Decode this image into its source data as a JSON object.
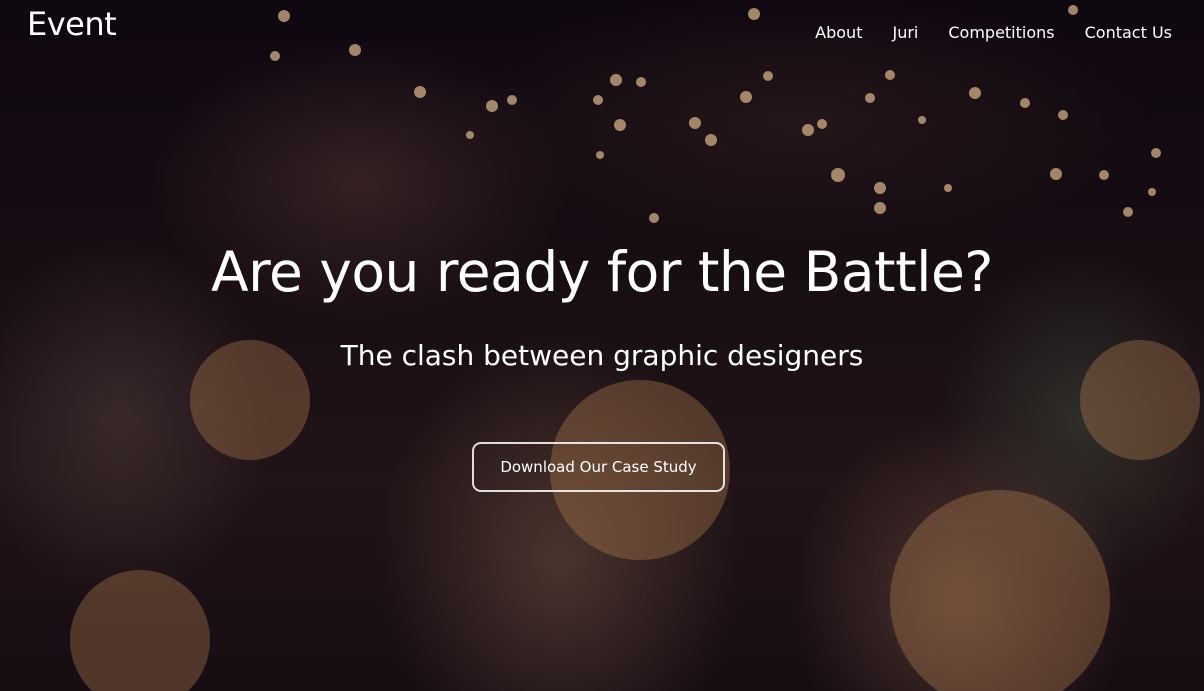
{
  "brand": {
    "logo_text": "Event"
  },
  "nav": {
    "items": [
      {
        "label": "About"
      },
      {
        "label": "Juri"
      },
      {
        "label": "Competitions"
      },
      {
        "label": "Contact Us"
      }
    ]
  },
  "hero": {
    "title": "Are you ready for the Battle?",
    "subtitle": "The clash between graphic designers",
    "cta_label": "Download Our Case Study"
  },
  "colors": {
    "text": "#ffffff",
    "button_border": "#ffffff",
    "background_dark": "#120a12"
  }
}
